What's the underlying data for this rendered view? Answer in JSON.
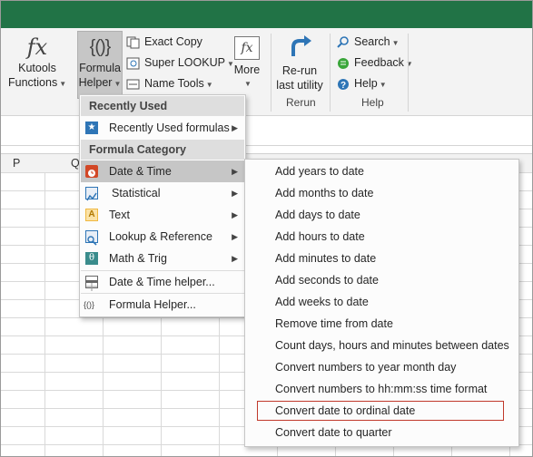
{
  "ribbon": {
    "kutools_functions": {
      "line1": "Kutools",
      "line2": "Functions"
    },
    "formula_helper": {
      "line1": "Formula",
      "line2": "Helper",
      "glyph": "{()}"
    },
    "exact_copy": "Exact Copy",
    "super_lookup": "Super LOOKUP",
    "name_tools": "Name Tools",
    "more": "More",
    "rerun": {
      "line1": "Re-run",
      "line2": "last utility"
    },
    "rerun_group": "Rerun",
    "search": "Search",
    "feedback": "Feedback",
    "help": "Help",
    "help_group": "Help",
    "fx_glyph": "fx"
  },
  "columns": {
    "p": "P",
    "q": "Q"
  },
  "menu": {
    "recently_used_header": "Recently Used",
    "recently_used_formulas": "Recently Used formulas",
    "formula_category_header": "Formula Category",
    "items": [
      {
        "label": "Date & Time",
        "icon": "date-time-icon",
        "color": "#d24726"
      },
      {
        "label": "Statistical",
        "icon": "statistical-icon",
        "color": "#2e75b6"
      },
      {
        "label": "Text",
        "icon": "text-icon",
        "color": "#f0b840"
      },
      {
        "label": "Lookup & Reference",
        "icon": "lookup-icon",
        "color": "#2e75b6"
      },
      {
        "label": "Math & Trig",
        "icon": "math-trig-icon",
        "color": "#3a8c8c"
      }
    ],
    "date_time_helper": "Date & Time helper...",
    "formula_helper": "Formula Helper..."
  },
  "submenu": {
    "items": [
      "Add years to date",
      "Add months to date",
      "Add days to date",
      "Add hours to date",
      "Add minutes to date",
      "Add seconds to date",
      "Add weeks to date",
      "Remove time from date",
      "Count days, hours and minutes between dates",
      "Convert numbers to year month day",
      "Convert numbers to hh:mm:ss time format",
      "Convert date to ordinal date",
      "Convert date to quarter"
    ],
    "highlighted_index": 11,
    "highlight_color": "#c0392b"
  },
  "colors": {
    "excel_green": "#217346",
    "menu_highlight": "#c6c6c6"
  }
}
